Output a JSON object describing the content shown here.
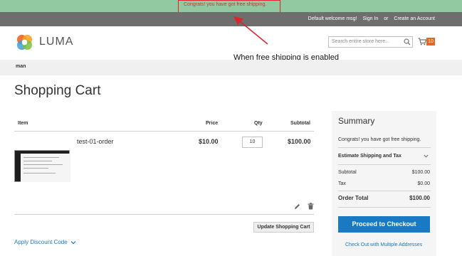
{
  "promo": {
    "message": "Congrats! you have got free shipping."
  },
  "header": {
    "welcome": "Default welcome msg!",
    "sign_in": "Sign In",
    "or": "or",
    "create_account": "Create an Account",
    "logo_text": "LUMA",
    "search_placeholder": "Search entire store here...",
    "cart_count": "10"
  },
  "annotation": {
    "text": "When free shipping is enabled"
  },
  "nav": {
    "item": "man"
  },
  "page": {
    "title": "Shopping Cart"
  },
  "cart": {
    "columns": {
      "item": "Item",
      "price": "Price",
      "qty": "Qty",
      "subtotal": "Subtotal"
    },
    "items": [
      {
        "name": "test-01-order",
        "price": "$10.00",
        "qty": "10",
        "subtotal": "$100.00"
      }
    ],
    "update_button": "Update Shopping Cart",
    "discount_link": "Apply Discount Code"
  },
  "summary": {
    "title": "Summary",
    "promo": "Congrats! you have got free shipping.",
    "estimate_shipping": "Estimate Shipping and Tax",
    "subtotal_label": "Subtotal",
    "subtotal_value": "$100.00",
    "tax_label": "Tax",
    "tax_value": "$0.00",
    "order_total_label": "Order Total",
    "order_total_value": "$100.00",
    "checkout_button": "Proceed to Checkout",
    "multi_address_link": "Check Out with Multiple Addresses"
  },
  "colors": {
    "promo_bar": "#93c9a0",
    "top_bar": "#6e6e6e",
    "accent": "#1979c3",
    "cart_badge": "#e7661f",
    "annotation": "#d9262b"
  },
  "icons": {
    "logo": "luma-logo-icon",
    "search": "search-icon",
    "cart": "cart-icon",
    "edit": "pencil-icon",
    "delete": "trash-icon",
    "chevron": "chevron-down-icon"
  }
}
